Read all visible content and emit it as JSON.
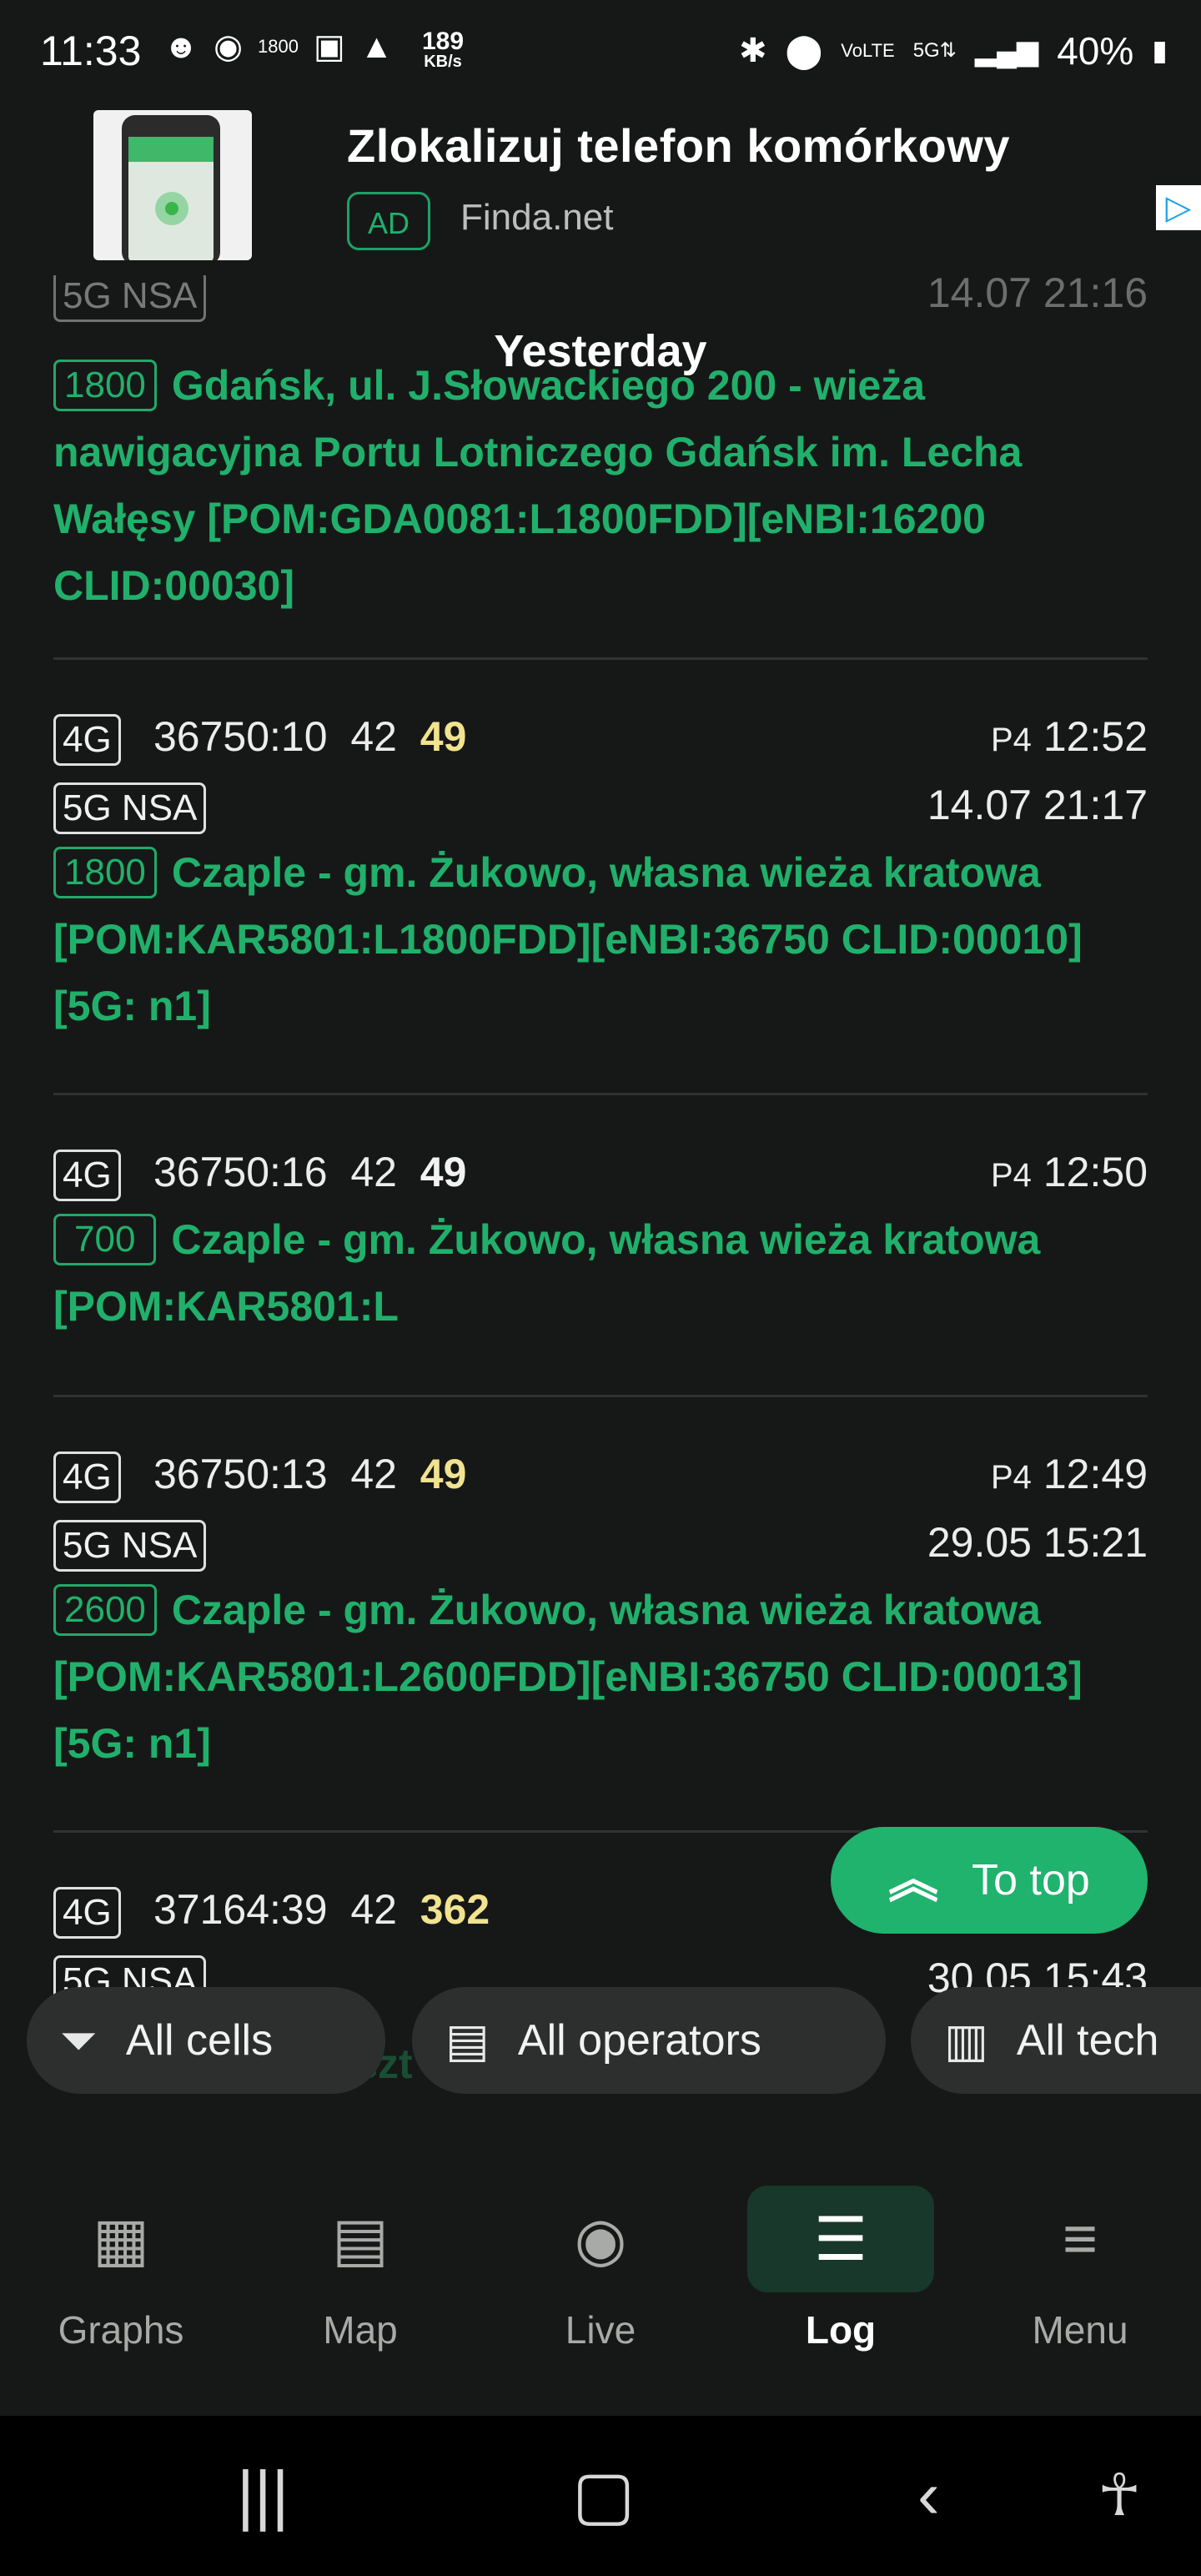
{
  "status_bar": {
    "time": "11:33",
    "speed_value": "189",
    "speed_unit": "KB/s",
    "network_label": "1800",
    "battery": "40%"
  },
  "ad": {
    "title": "Zlokalizuj telefon komórkowy",
    "badge": "AD",
    "source": "Finda.net"
  },
  "log": {
    "section_header": "Yesterday",
    "top_partial": {
      "tech": "5G NSA",
      "time": "14.07 21:16",
      "band": "1800",
      "description": "Gdańsk, ul. J.Słowackiego 200 - wieża nawigacyjna Portu Lotniczego Gdańsk im. Lecha Wałęsy [POM:GDA0081:L1800FDD][eNBI:16200 CLID:00030]"
    },
    "entries": [
      {
        "tech": "4G",
        "cell": "36750:10",
        "pci": "42",
        "signal": "49",
        "signal_color": "#f1e38f",
        "operator": "P4",
        "time": "12:52",
        "tech2": "5G NSA",
        "time2": "14.07 21:17",
        "band": "1800",
        "description": "Czaple - gm. Żukowo, własna wieża kratowa [POM:KAR5801:L1800FDD][eNBI:36750 CLID:00010][5G: n1]"
      },
      {
        "tech": "4G",
        "cell": "36750:16",
        "pci": "42",
        "signal": "49",
        "signal_color": "#f2f2f2",
        "operator": "P4",
        "time": "12:50",
        "band": "700",
        "description": "Czaple - gm. Żukowo, własna wieża kratowa [POM:KAR5801:L"
      },
      {
        "tech": "4G",
        "cell": "36750:13",
        "pci": "42",
        "signal": "49",
        "signal_color": "#f1e38f",
        "operator": "P4",
        "time": "12:49",
        "tech2": "5G NSA",
        "time2": "29.05 15:21",
        "band": "2600",
        "description": "Czaple - gm. Żukowo, własna wieża kratowa [POM:KAR5801:L2600FDD][eNBI:36750 CLID:00013][5G: n1]"
      },
      {
        "tech": "4G",
        "cell": "37164:39",
        "pci": "42",
        "signal": "362",
        "signal_color": "#f1e38f",
        "tech2": "5G NSA",
        "time2": "30.05 15:43",
        "description_tail": "5B - rurowy maszt Cellnex / On Tower"
      }
    ]
  },
  "to_top_label": "To top",
  "filters": {
    "cells": "All cells",
    "operators": "All operators",
    "tech": "All tech"
  },
  "bottom_nav": {
    "graphs": "Graphs",
    "map": "Map",
    "live": "Live",
    "log": "Log",
    "menu": "Menu"
  }
}
